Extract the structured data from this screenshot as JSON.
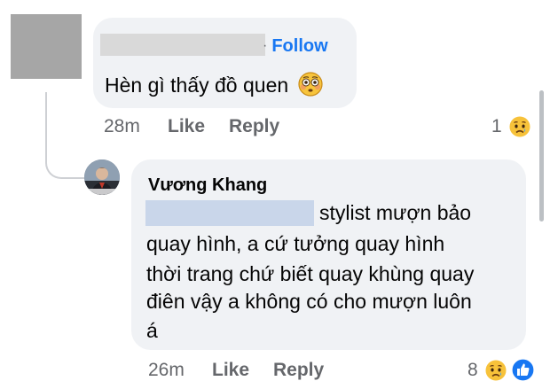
{
  "comment1": {
    "follow_separator": "·",
    "follow_label": "Follow",
    "text": "Hèn gì thấy đồ quen",
    "text_emoji_icon": "flushed-face-icon",
    "time": "28m",
    "like_label": "Like",
    "reply_label": "Reply",
    "reaction_count": "1",
    "reaction_icons": [
      "sad-reaction-icon"
    ]
  },
  "comment2": {
    "author": "Vương Khang",
    "lines": [
      "stylist mượn bảo",
      "quay hình, a cứ tưởng  quay hình",
      "thời trang chứ biết quay khùng quay",
      "điên vậy a không có cho mượn luôn",
      "á"
    ],
    "time": "26m",
    "like_label": "Like",
    "reply_label": "Reply",
    "reaction_count": "8",
    "reaction_icons": [
      "sad-reaction-icon",
      "like-reaction-icon"
    ]
  },
  "colors": {
    "bubble_bg": "#f0f2f5",
    "follow_blue": "#1877f2",
    "meta_gray": "#65676b",
    "redaction_gray": "#d9d9d9",
    "redaction_blue": "#c9d6ea"
  }
}
